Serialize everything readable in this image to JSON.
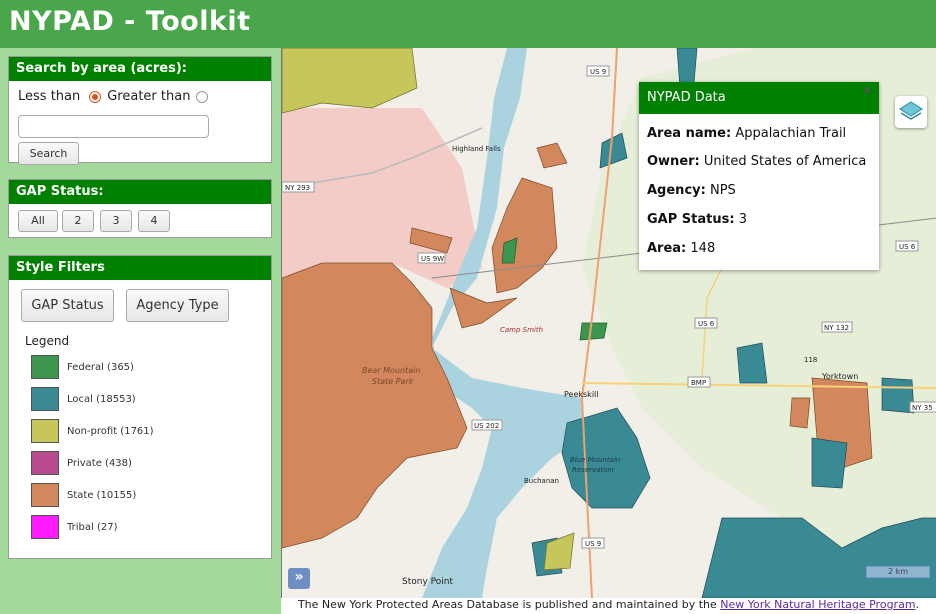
{
  "app": {
    "title": "NYPAD - Toolkit"
  },
  "search_panel": {
    "title": "Search by area (acres):",
    "less_than_label": "Less than",
    "greater_than_label": "Greater than",
    "selected_option": "Less than",
    "input_value": "",
    "search_button": "Search"
  },
  "gap_panel": {
    "title": "GAP Status:",
    "buttons": [
      "All",
      "2",
      "3",
      "4"
    ]
  },
  "style_panel": {
    "title": "Style Filters",
    "buttons": [
      "GAP Status",
      "Agency Type"
    ],
    "legend_title": "Legend",
    "legend": [
      {
        "label": "Federal (365)",
        "color": "#3d9650"
      },
      {
        "label": "Local (18553)",
        "color": "#3a8a96"
      },
      {
        "label": "Non-profit (1761)",
        "color": "#c6c65a"
      },
      {
        "label": "Private (438)",
        "color": "#b84a8e"
      },
      {
        "label": "State (10155)",
        "color": "#d2875c"
      },
      {
        "label": "Tribal (27)",
        "color": "#ff1aff"
      }
    ]
  },
  "popup": {
    "title": "NYPAD Data",
    "close_glyph": "×",
    "rows": [
      {
        "key": "Area name:",
        "value": "Appalachian Trail"
      },
      {
        "key": "Owner:",
        "value": "United States of America"
      },
      {
        "key": "Agency:",
        "value": "NPS"
      },
      {
        "key": "GAP Status:",
        "value": "3"
      },
      {
        "key": "Area:",
        "value": "148"
      }
    ]
  },
  "map": {
    "labels": {
      "highland_falls": "Highland Falls",
      "camp_smith": "Camp Smith",
      "bear_mountain": "Bear Mountain",
      "state_park": "State Park",
      "peekskill": "Peekskill",
      "buchanan": "Buchanan",
      "yorktown": "Yorktown",
      "stony_point": "Stony Point",
      "blue_mountain": "Blue Mountain",
      "reservation": "Reservation",
      "us9": "US 9",
      "us9w": "US 9W",
      "us6": "US 6",
      "ny293": "NY 293",
      "bmp": "BMP",
      "us202": "US 202",
      "ny35": "NY 35",
      "ny132": "NY 132",
      "ny118": "118"
    },
    "expand_glyph": "»",
    "scale_label": "2 km"
  },
  "footer": {
    "text": "The New York Protected Areas Database is published and maintained by the ",
    "link": "New York Natural Heritage Program",
    "suffix": "."
  }
}
